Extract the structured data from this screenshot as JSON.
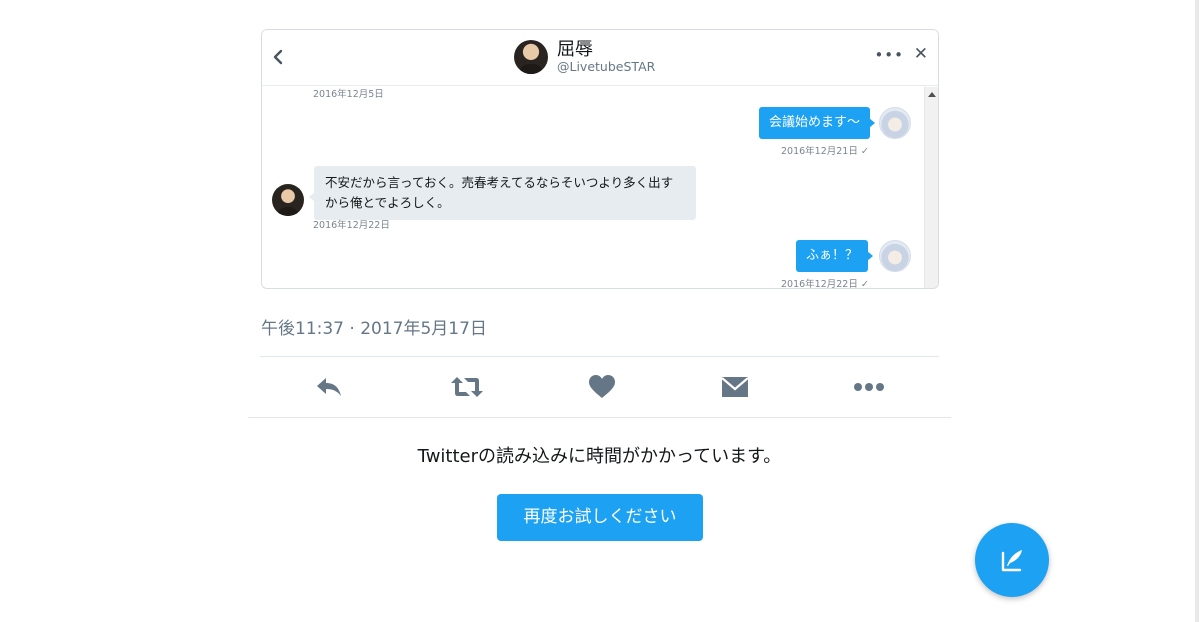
{
  "embedded_dm": {
    "contact_name": "屈辱",
    "contact_handle": "@LivetubeSTAR",
    "more_icon": "more-horizontal-icon",
    "close_icon": "close-icon",
    "back_icon": "chevron-left-icon",
    "messages": [
      {
        "sender": "them",
        "timestamp": "2016年12月5日"
      },
      {
        "sender": "me",
        "text": "会議始めます～",
        "timestamp": "2016年12月21日 ✓"
      },
      {
        "sender": "them",
        "text_line1": "不安だから言っておく。売春考えてるならそいつより多く出す",
        "text_line2": "から俺とでよろしく。",
        "timestamp": "2016年12月22日"
      },
      {
        "sender": "me",
        "text": "ふぁ！？",
        "timestamp": "2016年12月22日 ✓"
      }
    ]
  },
  "tweet": {
    "time": "午後11:37 · 2017年5月17日"
  },
  "actions": [
    "reply-icon",
    "retweet-icon",
    "like-icon",
    "direct-message-icon",
    "more-icon"
  ],
  "loading": {
    "message": "Twitterの読み込みに時間がかかっています。",
    "retry_label": "再度お試しください"
  },
  "colors": {
    "accent": "#1da1f2",
    "icon_gray": "#657786",
    "divider": "#e1e8ed"
  }
}
